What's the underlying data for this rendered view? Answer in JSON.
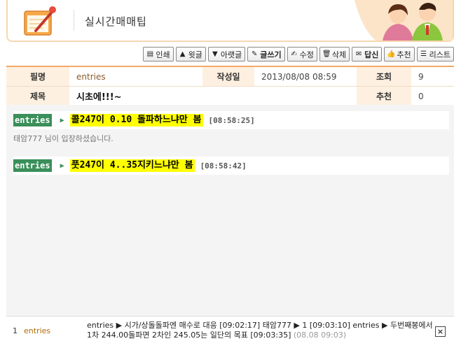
{
  "header": {
    "title": "실시간매매팁"
  },
  "toolbar": [
    {
      "id": "print",
      "label": "인쇄",
      "icon": "printer-icon",
      "glyph": "▤"
    },
    {
      "id": "prev",
      "label": "윗글",
      "icon": "prev-post-icon",
      "glyph": "▲"
    },
    {
      "id": "next",
      "label": "아랫글",
      "icon": "next-post-icon",
      "glyph": "▼"
    },
    {
      "id": "write",
      "label": "글쓰기",
      "icon": "pencil-icon",
      "glyph": "✎"
    },
    {
      "id": "edit",
      "label": "수정",
      "icon": "edit-icon",
      "glyph": "✍"
    },
    {
      "id": "delete",
      "label": "삭제",
      "icon": "trash-icon",
      "glyph": "🗑"
    },
    {
      "id": "reply",
      "label": "답신",
      "icon": "reply-icon",
      "glyph": "✉"
    },
    {
      "id": "recommend",
      "label": "추천",
      "icon": "thumbs-up-icon",
      "glyph": "👍"
    },
    {
      "id": "list",
      "label": "리스트",
      "icon": "list-icon",
      "glyph": "☰"
    }
  ],
  "post": {
    "author_label": "필명",
    "author": "entries",
    "date_label": "작성일",
    "date": "2013/08/08 08:59",
    "views_label": "조회",
    "views": "9",
    "subject_label": "제목",
    "subject": "시초에!!!~",
    "recommend_label": "추천",
    "recommend": "0"
  },
  "chat": {
    "messages": [
      {
        "nick": "entries",
        "text": "콜247이 0.10 돌파하느냐만 봄",
        "time": "[08:58:25]"
      },
      {
        "nick": "entries",
        "text": "풋247이 4..35지키느냐만 봄",
        "time": "[08:58:42]"
      }
    ],
    "notice": "태암777 님이 입장하셨습니다."
  },
  "footer": {
    "num": "1",
    "nick": "entries",
    "ticker": "entries ▶ 시가/상돌돌파엔 매수로 대응 [09:02:17] 태암777 ▶ 1 [09:03:10] entries ▶ 두번째봉에서 1차 244.00돌파면 2차인 245.05는 일단의 목표 [09:03:35]",
    "ticker_time": "(08.08 09:03)",
    "close": "×"
  }
}
